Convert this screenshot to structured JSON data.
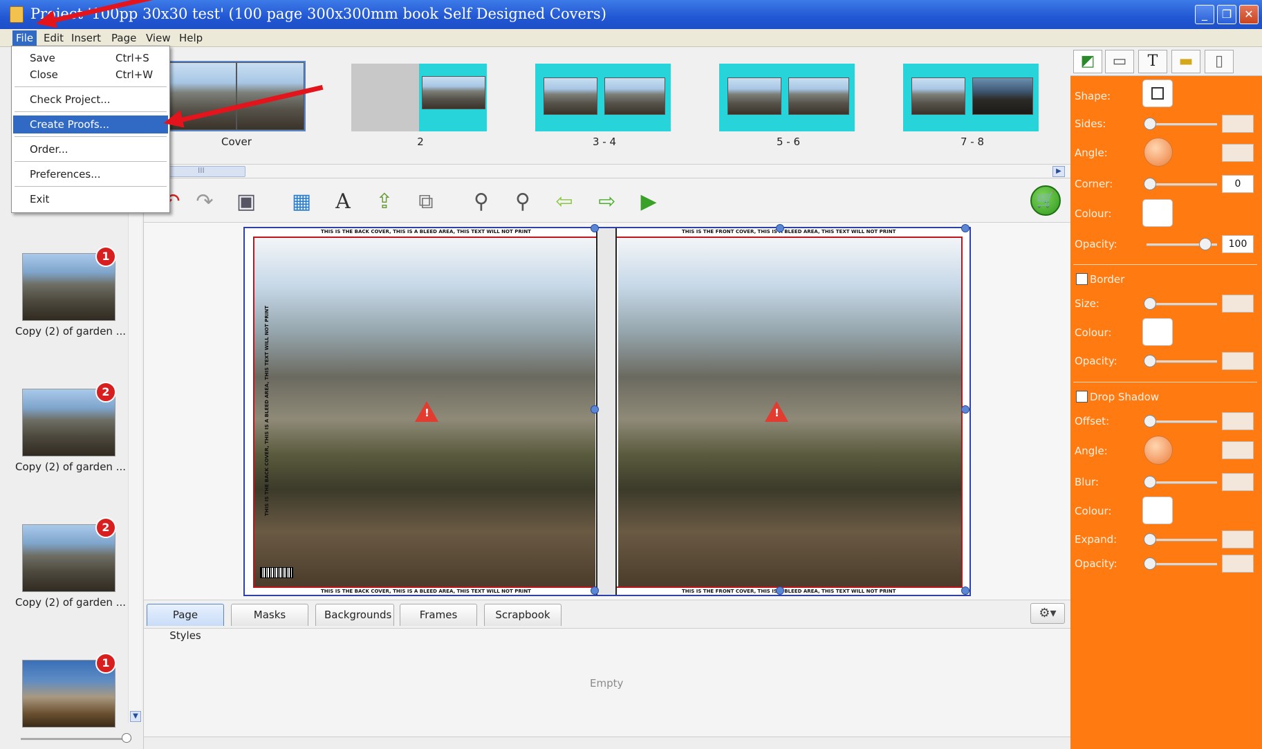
{
  "window": {
    "title": "Project '100pp 30x30 test' (100 page 300x300mm book Self Designed Covers)"
  },
  "menubar": {
    "items": [
      "File",
      "Edit",
      "Insert",
      "Page",
      "View",
      "Help"
    ]
  },
  "file_menu": {
    "items": [
      {
        "label": "Save",
        "shortcut": "Ctrl+S"
      },
      {
        "label": "Close",
        "shortcut": "Ctrl+W"
      },
      {
        "label": "Check Project..."
      },
      {
        "label": "Create Proofs..."
      },
      {
        "label": "Order..."
      },
      {
        "label": "Preferences..."
      },
      {
        "label": "Exit"
      }
    ],
    "highlighted": "Create Proofs..."
  },
  "filmstrip": {
    "spreads": [
      {
        "label": "Cover"
      },
      {
        "label": "2"
      },
      {
        "label": "3 - 4"
      },
      {
        "label": "5 - 6"
      },
      {
        "label": "7 - 8"
      }
    ],
    "scroll_grip": "III"
  },
  "toolbar": {
    "icons": [
      "undo-icon",
      "redo-icon",
      "save-icon",
      "add-photo-icon",
      "add-text-icon",
      "import-icon",
      "replace-icon",
      "zoom-out-icon",
      "zoom-in-icon",
      "previous-page-icon",
      "next-page-icon",
      "play-icon",
      "cart-icon"
    ]
  },
  "canvas": {
    "back_cover_text": "THIS IS THE BACK COVER, THIS IS A BLEED AREA, THIS TEXT WILL NOT PRINT",
    "front_cover_text": "THIS IS THE FRONT COVER, THIS IS A BLEED AREA, THIS TEXT WILL NOT PRINT",
    "spine_text": "THIS IS THE BACK COVER, THIS IS A BLEED AREA, THIS TEXT WILL NOT PRINT"
  },
  "left_panel": {
    "items": [
      {
        "caption": "Copy (2) of garden ...",
        "badge": "1"
      },
      {
        "caption": "Copy (2) of garden ...",
        "badge": "2"
      },
      {
        "caption": "Copy (2) of garden ...",
        "badge": "2"
      },
      {
        "caption": "",
        "badge": "1"
      }
    ]
  },
  "tabs": {
    "items": [
      "Page Styles",
      "Masks",
      "Backgrounds",
      "Frames",
      "Scrapbook"
    ],
    "selected": "Page Styles",
    "content_empty": "Empty"
  },
  "properties": {
    "shape_label": "Shape:",
    "sides_label": "Sides:",
    "angle_label": "Angle:",
    "corner_label": "Corner:",
    "corner_value": "0",
    "colour_label": "Colour:",
    "opacity_label": "Opacity:",
    "opacity_value": "100",
    "border": {
      "label": "Border",
      "size_label": "Size:",
      "colour_label": "Colour:",
      "opacity_label": "Opacity:"
    },
    "drop_shadow": {
      "label": "Drop Shadow",
      "offset_label": "Offset:",
      "angle_label": "Angle:",
      "blur_label": "Blur:",
      "colour_label": "Colour:",
      "expand_label": "Expand:",
      "opacity_label": "Opacity:"
    },
    "tab_icons": [
      "shape-icon",
      "frame-icon",
      "text-icon",
      "ruler-icon",
      "page-icon"
    ],
    "accent_color": "#ff7a10"
  }
}
